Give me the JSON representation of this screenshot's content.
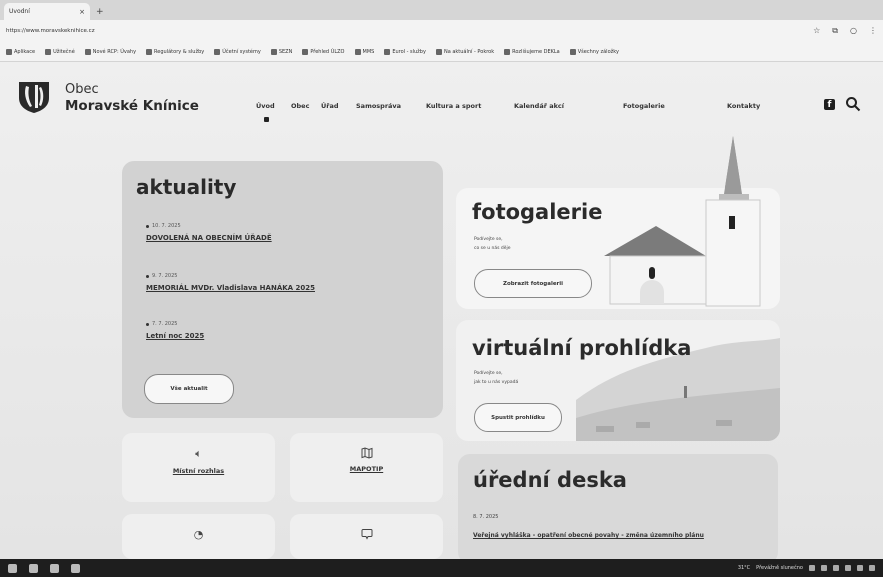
{
  "browser": {
    "tab_title": "Úvodní",
    "tab_close": "×",
    "new_tab": "+",
    "url": "https://www.moravskeknihice.cz",
    "bookmarks": [
      "Aplikace",
      "Užitečné",
      "Nové RCP: Úvahy",
      "Regulátory & služby",
      "Účetní systémy",
      "SEZN",
      "Přehled ÚLZO",
      "MMS",
      "Eurol - služby",
      "Na aktuální - Pokrok",
      "Rozlišujeme DEKLa",
      "Všechny záložky"
    ]
  },
  "site": {
    "brand_line1": "Obec",
    "brand_line2": "Moravské Knínice",
    "nav": [
      "Úvod",
      "Obec",
      "Úřad",
      "Samospráva",
      "Kultura a sport",
      "Kalendář akcí",
      "Fotogalerie",
      "Kontakty"
    ],
    "facebook": "f"
  },
  "news": {
    "title": "aktuality",
    "items": [
      {
        "date": "10. 7. 2025",
        "title": "DOVOLENÁ NA OBECNÍM ÚŘADĚ"
      },
      {
        "date": "9. 7. 2025",
        "title": "MEMORIÁL MVDr. Vladislava HANÁKA 2025"
      },
      {
        "date": "7. 7. 2025",
        "title": "Letní noc 2025"
      }
    ],
    "all_button": "Vše aktualit"
  },
  "gallery": {
    "title": "fotogalerie",
    "sub1": "Podívejte se,",
    "sub2": "co se u nás děje",
    "button": "Zobrazit fotogalerii"
  },
  "virtual": {
    "title": "virtuální prohlídka",
    "sub1": "Podívejte se,",
    "sub2": "jak to u nás vypadá",
    "button": "Spustit prohlídku"
  },
  "desk": {
    "title": "úřední deska",
    "date": "8. 7. 2025",
    "item": "Veřejná vyhláška - opatření obecné povahy - změna územního plánu"
  },
  "tiles": [
    {
      "label": "Místní rozhlas"
    },
    {
      "label": "MAPOTIP"
    },
    {
      "label": ""
    },
    {
      "label": ""
    }
  ],
  "taskbar": {
    "weather": "31°C",
    "status": "Převážně slunečno"
  }
}
